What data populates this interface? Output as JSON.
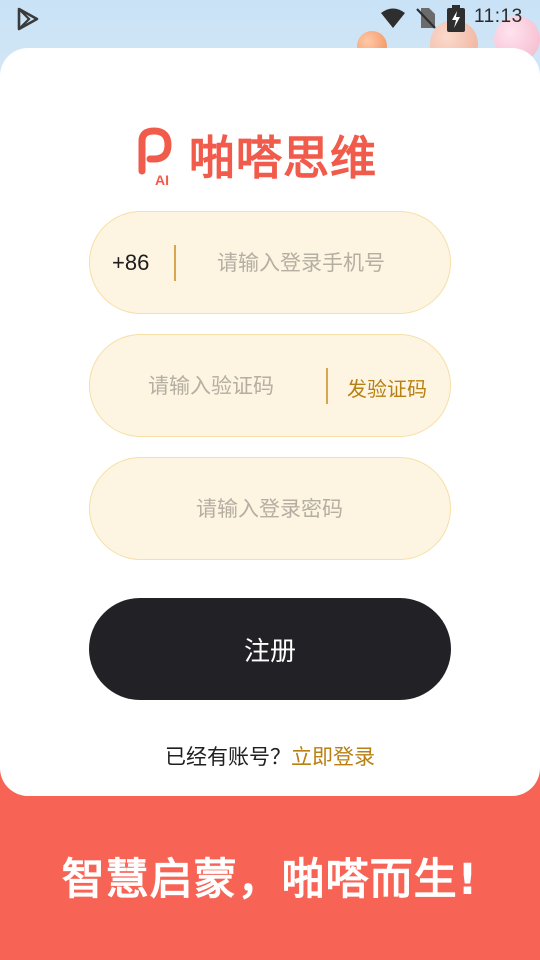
{
  "status_bar": {
    "time": "11:13",
    "icons": [
      "play-store-icon",
      "wifi-icon",
      "no-sim-icon",
      "battery-charging-icon"
    ]
  },
  "brand": {
    "logo_mark_text": "AI",
    "name": "啪嗒思维",
    "color": "#f15b4c"
  },
  "form": {
    "phone": {
      "country_code": "+86",
      "placeholder": "请输入登录手机号",
      "value": ""
    },
    "code": {
      "placeholder": "请输入验证码",
      "value": "",
      "send_label": "发验证码"
    },
    "password": {
      "placeholder": "请输入登录密码",
      "value": ""
    },
    "submit_label": "注册"
  },
  "footer_link": {
    "prompt": "已经有账号？",
    "link": "立即登录"
  },
  "slogan": "智慧启蒙，啪嗒而生!",
  "colors": {
    "accent": "#f76355",
    "field_bg": "#fdf5e1",
    "link": "#b88013",
    "button": "#222126"
  }
}
